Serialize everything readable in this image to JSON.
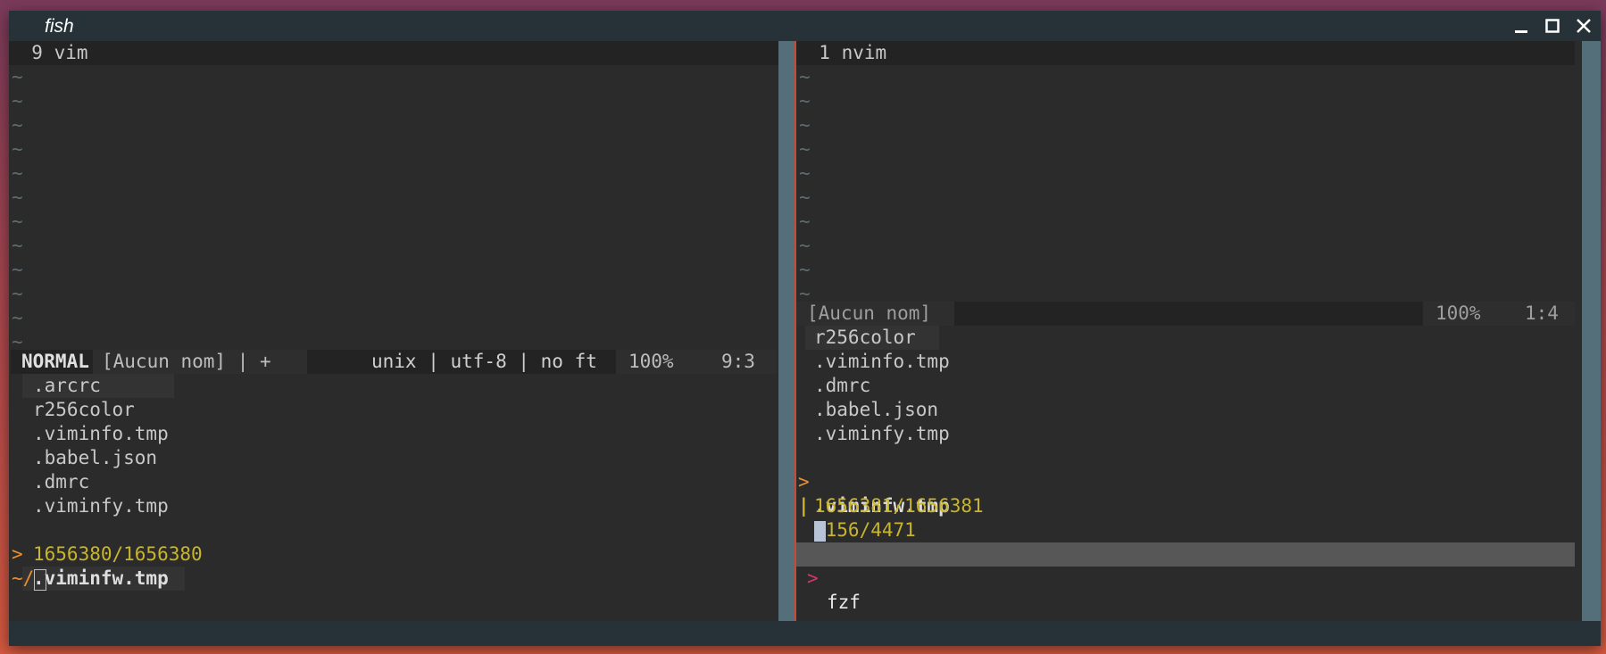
{
  "window": {
    "title": "fish"
  },
  "left": {
    "tabline": "  9 vim",
    "tildes": [
      "~",
      "~",
      "~",
      "~",
      "~",
      "~",
      "~",
      "~",
      "~",
      "~",
      "~",
      "~",
      "~"
    ],
    "status": {
      "mode": "NORMAL",
      "filename": "[Aucun nom] | +",
      "info": "unix | utf-8 | no ft",
      "percent": "100%",
      "position": "9:3"
    },
    "files": [
      ".arcrc",
      "r256color",
      ".viminfo.tmp",
      ".babel.json",
      ".dmrc",
      ".viminfy.tmp"
    ],
    "selected_marker": ">",
    "selected_file": ".viminfw.tmp",
    "count": "1656380/1656380",
    "prompt": "~/"
  },
  "right": {
    "tabline": "  1 nvim",
    "tildes": [
      "~",
      "~",
      "~",
      "~",
      "~",
      "~",
      "~",
      "~",
      "~",
      "~",
      "~"
    ],
    "status": {
      "filename": "[Aucun nom]",
      "percent": "100%",
      "position": "1:4"
    },
    "files": [
      "r256color",
      ".viminfo.tmp",
      ".dmrc",
      ".babel.json",
      ".viminfy.tmp"
    ],
    "selected_marker": ">",
    "selected_file": ".viminfw.tmp",
    "progress_marker": "|",
    "progress": "2156/4471",
    "count": "1656381/1656381",
    "fzf_marker": ">",
    "fzf_label": "fzf"
  },
  "colors": {
    "accent_orange": "#e8912d",
    "count_yellow": "#c9b52c",
    "prompt_pink": "#d8336b",
    "divider": "#546e7a"
  }
}
